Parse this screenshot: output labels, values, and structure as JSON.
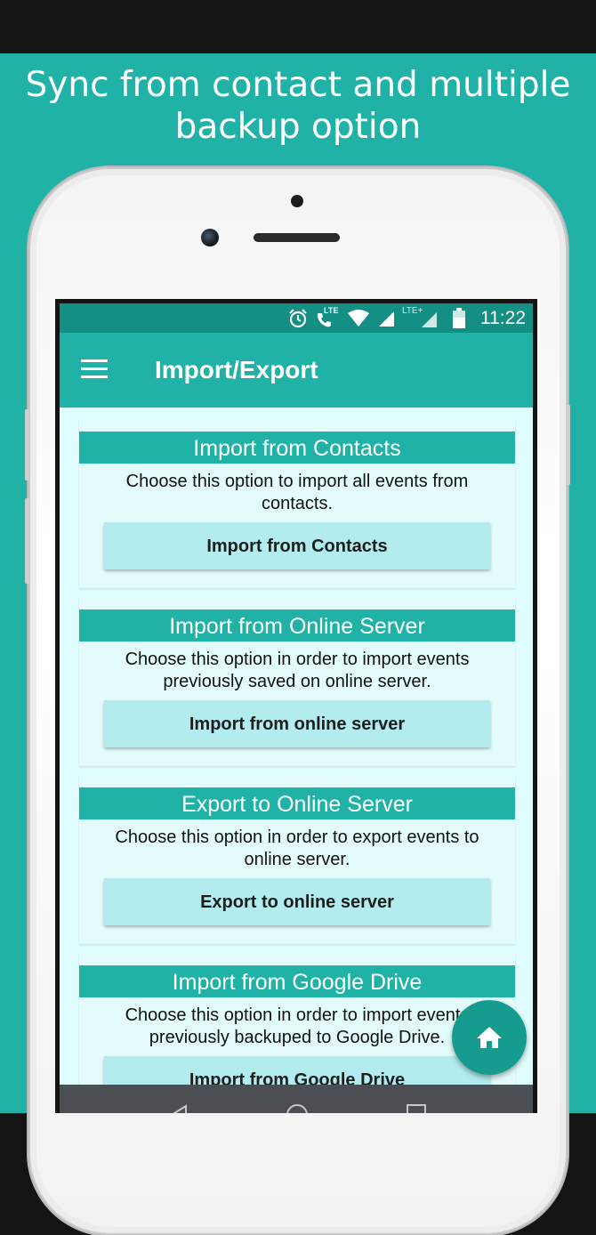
{
  "headline": "Sync from contact and multiple backup option",
  "status": {
    "time": "11:22",
    "icons": [
      "alarm-icon",
      "call-lte-icon",
      "wifi-icon",
      "signal-icon",
      "lte-plus-signal-icon",
      "battery-icon"
    ],
    "lte_label": "LTE",
    "lte_plus_label": "LTE+"
  },
  "appbar": {
    "title": "Import/Export",
    "menu_icon": "hamburger-menu-icon"
  },
  "cards": [
    {
      "title": "Import from Contacts",
      "description": "Choose this option to import all events from contacts.",
      "button": "Import from Contacts"
    },
    {
      "title": "Import from Online Server",
      "description": "Choose this option in order to import events previously saved on online server.",
      "button": "Import from online server"
    },
    {
      "title": "Export to Online Server",
      "description": "Choose this option in order to export events to online server.",
      "button": "Export to online server"
    },
    {
      "title": "Import from Google Drive",
      "description": "Choose this option in order to import events previously backuped to Google Drive.",
      "button": "Import from Google Drive"
    }
  ],
  "fab": {
    "icon": "home-icon"
  },
  "colors": {
    "teal": "#20b2a6",
    "status_teal": "#148f84",
    "card_bg": "#e3fbfb",
    "button_bg": "#b2ecee",
    "fab": "#169c8f"
  }
}
